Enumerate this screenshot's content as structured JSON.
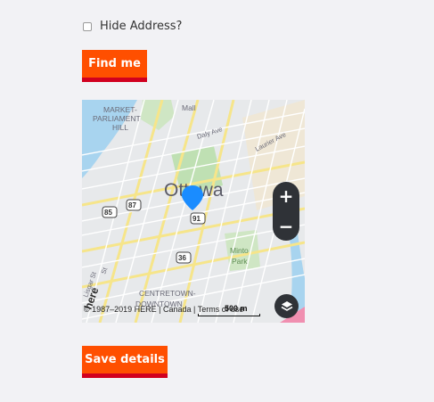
{
  "form": {
    "hide_address_label": "Hide Address?",
    "hide_address_checked": false,
    "find_button_label": "Find me",
    "save_button_label": "Save details"
  },
  "map": {
    "city_label": "Ottawa",
    "district_labels": [
      "MARKET-",
      "PARLIAMENT",
      "HILL",
      "CENTRETOWN-",
      "DOWNTOWN"
    ],
    "park_labels": [
      "Minto",
      "Park",
      "Mall"
    ],
    "street_labels": [
      "Daly Ave",
      "Laurier Ave",
      "St",
      "Lisgar St",
      "here"
    ],
    "route_shields": [
      "85",
      "87",
      "91",
      "36"
    ],
    "copyright": "© 1987–2019 HERE | Canada | Terms of use",
    "scale_label": "500 m",
    "zoom_in_label": "+",
    "zoom_out_label": "−",
    "marker_color": "#1a8cff"
  },
  "colors": {
    "button_bg": "#ff4f00",
    "button_border": "#d1001f"
  }
}
